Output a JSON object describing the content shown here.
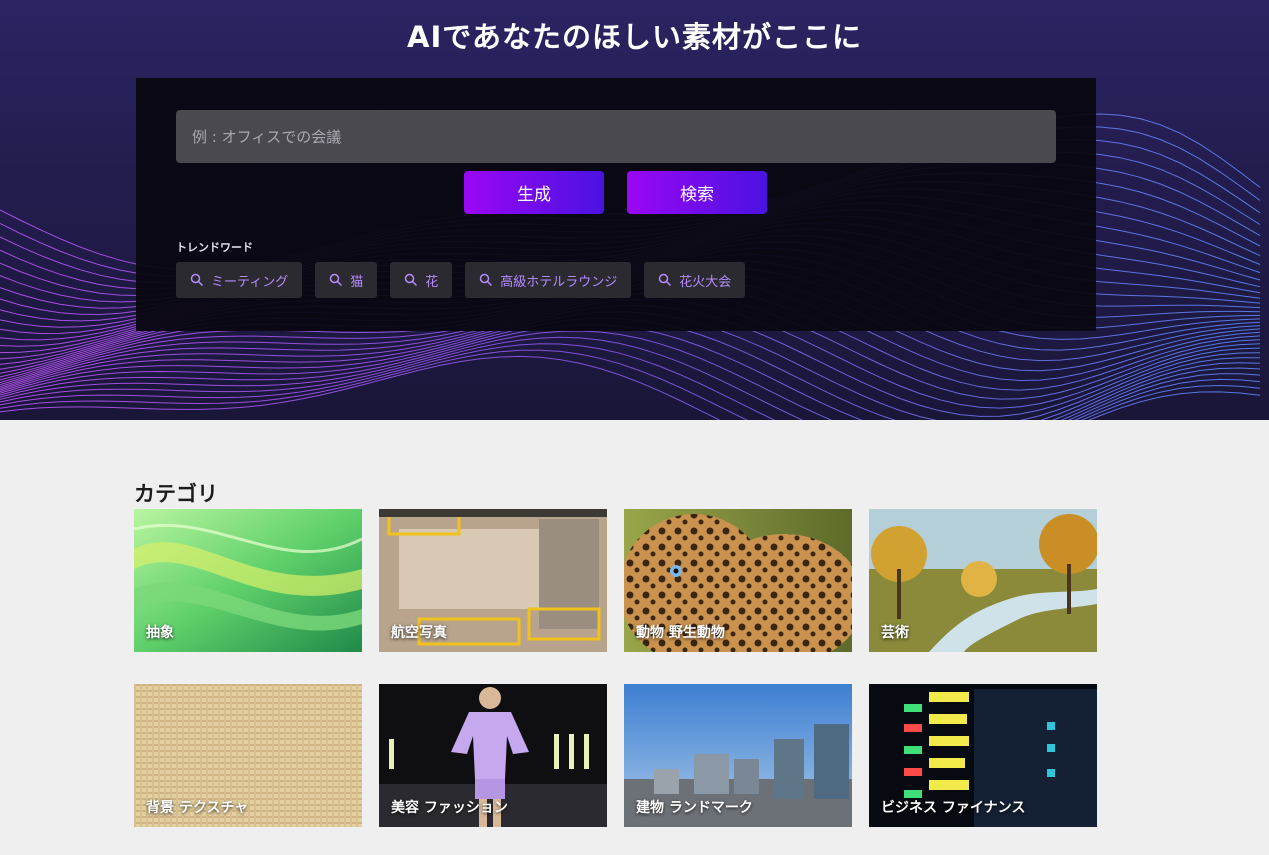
{
  "hero": {
    "title": "AIであなたのほしい素材がここに",
    "search": {
      "placeholder": "例 : オフィスでの会議",
      "value": ""
    },
    "buttons": {
      "generate": "生成",
      "search": "検索"
    },
    "trend_label": "トレンドワード",
    "trends": [
      "ミーティング",
      "猫",
      "花",
      "高級ホテルラウンジ",
      "花火大会"
    ]
  },
  "categories": {
    "title": "カテゴリ",
    "items": [
      {
        "label": "抽象",
        "image": "abstract-green-waves"
      },
      {
        "label": "航空写真",
        "image": "aerial-industrial-site"
      },
      {
        "label": "動物 野生動物",
        "image": "leopard-closeup"
      },
      {
        "label": "芸術",
        "image": "autumn-river-painting"
      },
      {
        "label": "背景 テクスチャ",
        "image": "burlap-texture"
      },
      {
        "label": "美容 ファッション",
        "image": "fashion-runway-model"
      },
      {
        "label": "建物 ランドマーク",
        "image": "city-skyscrapers"
      },
      {
        "label": "ビジネス ファイナンス",
        "image": "stock-ticker-board"
      }
    ]
  },
  "colors": {
    "accent_gradient_start": "#9b07f4",
    "accent_gradient_end": "#4a12e0",
    "chip_text": "#b58cff",
    "page_background": "#efefef"
  }
}
